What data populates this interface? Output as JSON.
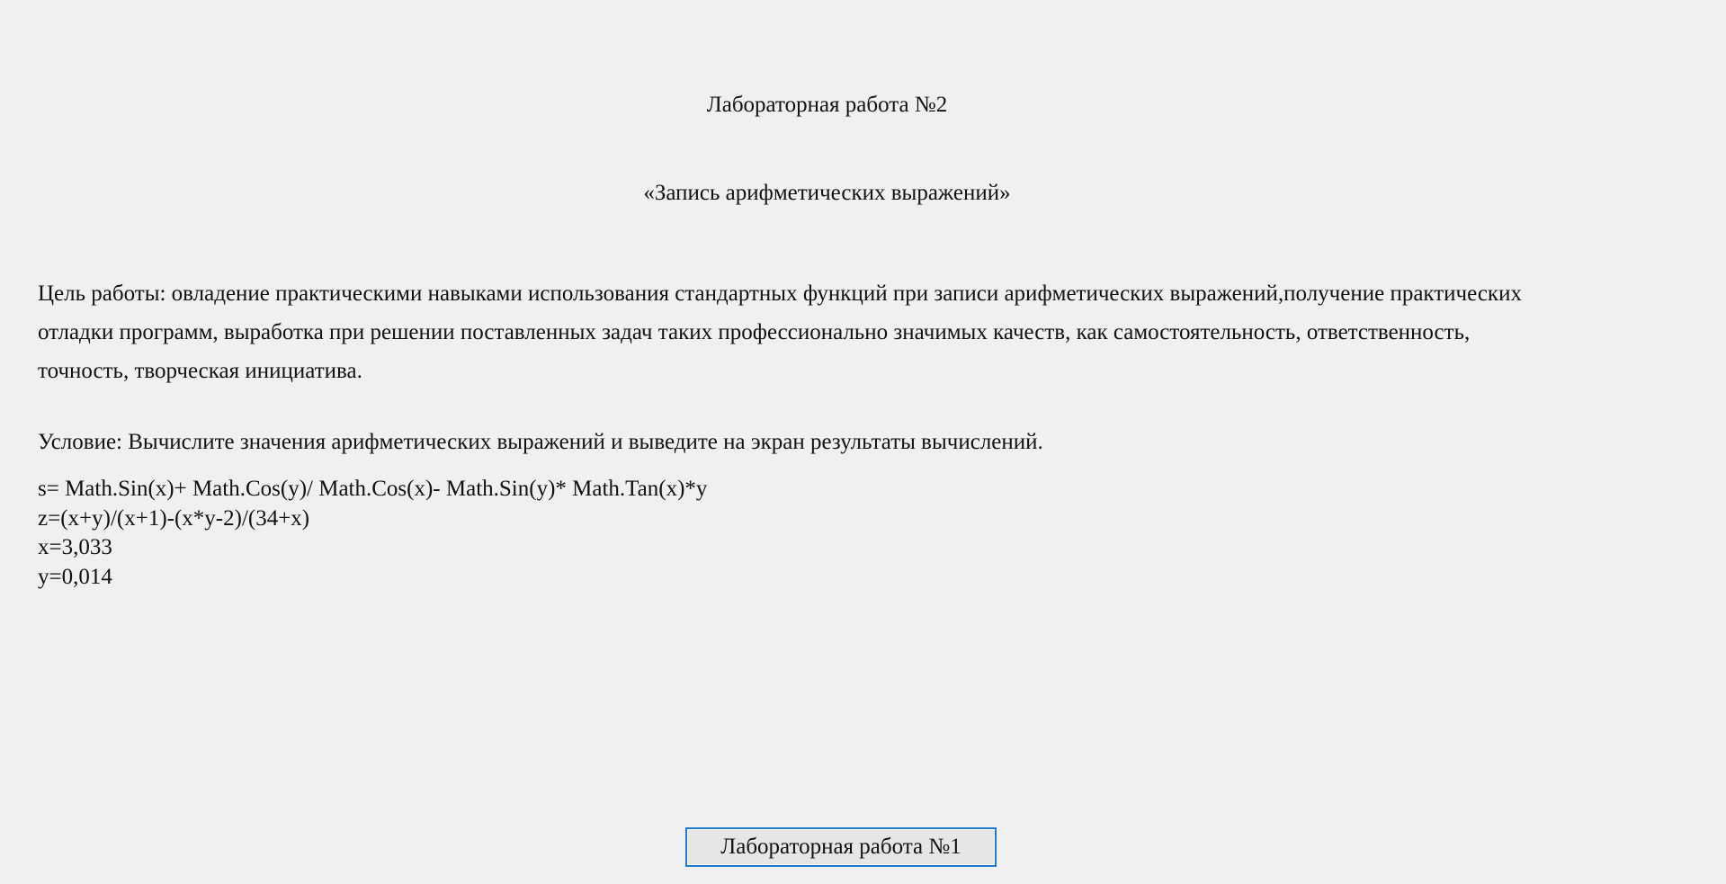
{
  "page": {
    "title": "Лабораторная работа №2",
    "subtitle": "«Запись арифметических выражений»"
  },
  "goal": {
    "lines": [
      "Цель работы: овладение практическими навыками использования стандартных функций при записи арифметических  выражений,получение практических",
      "отладки программ, выработка при решении поставленных задач таких профессионально значимых качеств, как самостоятельность, ответственность,",
      "точность, творческая инициатива."
    ]
  },
  "condition": {
    "text": "Условие: Вычислите значения арифметических выражений и выведите на экран результаты вычислений."
  },
  "formulas": {
    "s": "s= Math.Sin(x)+ Math.Cos(y)/ Math.Cos(x)- Math.Sin(y)* Math.Tan(x)*y",
    "z": "z=(x+y)/(x+1)-(x*y-2)/(34+x)",
    "x": "x=3,033",
    "y": "y=0,014"
  },
  "nav": {
    "button_label": "Лабораторная работа №1"
  },
  "colors": {
    "background": "#f0f0f0",
    "button_border": "#1f78d1",
    "text": "#111111"
  }
}
